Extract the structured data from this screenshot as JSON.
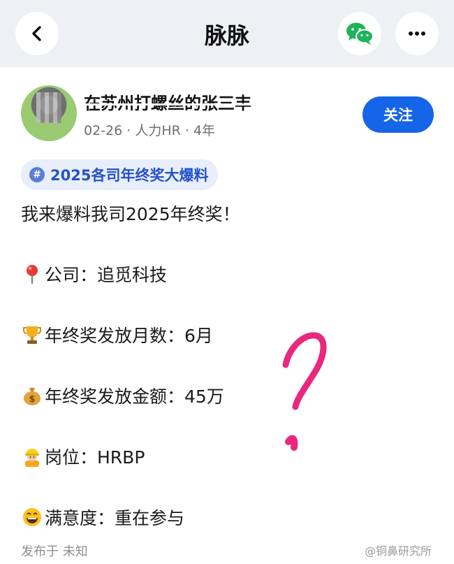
{
  "header": {
    "title": "脉脉",
    "back_icon": "chevron-left-icon",
    "share_icon": "wechat-icon",
    "more_icon": "more-horizontal-icon"
  },
  "author": {
    "name": "在苏州打螺丝的张三丰",
    "meta": "02-26 · 人力HR · 4年",
    "follow_label": "关注",
    "accent_color": "#1565e8"
  },
  "topic": {
    "label": "2025各司年终奖大爆料",
    "icon": "hashtag-icon"
  },
  "post": {
    "intro": "我来爆料我司2025年终奖！",
    "lines": [
      {
        "icon": "pin-icon",
        "text": "公司：追觅科技"
      },
      {
        "icon": "trophy-icon",
        "text": "年终奖发放月数：6月"
      },
      {
        "icon": "money-bag-icon",
        "text": "年终奖发放金额：45万"
      },
      {
        "icon": "worker-icon",
        "text": "岗位：HRBP"
      },
      {
        "icon": "grinning-face-icon",
        "text": "满意度：重在参与"
      }
    ]
  },
  "annotation": {
    "mark": "?",
    "color": "#e8287f"
  },
  "footer": {
    "published": "发布于 未知",
    "watermark": "@铜鼻研究所"
  }
}
